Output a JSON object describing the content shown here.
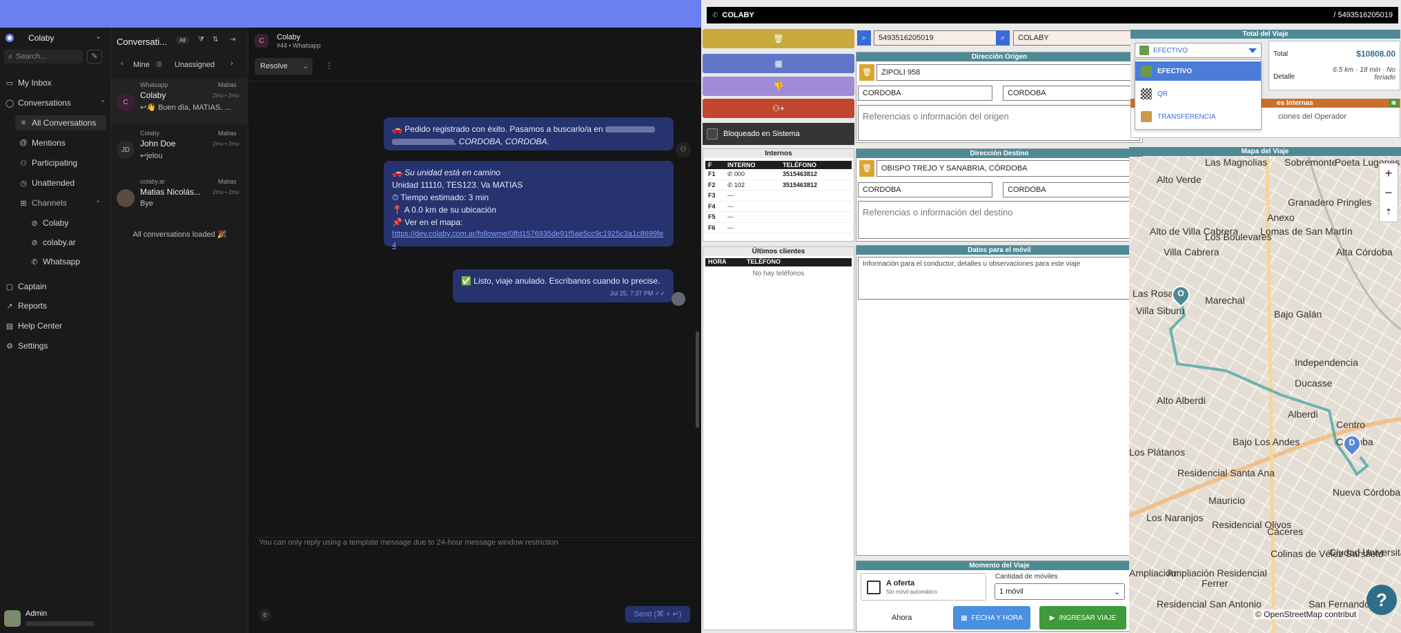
{
  "sidebar": {
    "account": "Colaby",
    "search_placeholder": "Search...",
    "items": {
      "inbox": "My Inbox",
      "conversations": "Conversations",
      "all": "All Conversations",
      "mentions": "Mentions",
      "participating": "Participating",
      "unattended": "Unattended",
      "channels": "Channels",
      "ch_colaby": "Colaby",
      "ch_colabyar": "colaby.ar",
      "ch_whatsapp": "Whatsapp",
      "captain": "Captain",
      "reports": "Reports",
      "help": "Help Center",
      "settings": "Settings"
    },
    "user": "Admin"
  },
  "convlist": {
    "title": "Conversati...",
    "filter_all": "All",
    "tab_mine": "Mine",
    "mine_count": "0",
    "tab_unassigned": "Unassigned",
    "loaded": "All conversations loaded 🎉",
    "items": [
      {
        "avatar": "C",
        "inbox": "Whatsapp",
        "agent": "Matias",
        "name": "Colaby",
        "time": "2mo • 2mo",
        "preview": "↩👋 Buen día, MATIAS. ..."
      },
      {
        "avatar": "JD",
        "inbox": "Colaby",
        "agent": "Matias",
        "name": "John Doe",
        "time": "2mo • 2mo",
        "preview": "↩jelou"
      },
      {
        "avatar": "",
        "inbox": "colaby.ar",
        "agent": "Matias",
        "name": "Matias Nicolás...",
        "time": "2mo • 2mo",
        "preview": "Bye"
      }
    ]
  },
  "chat": {
    "avatar": "C",
    "name": "Colaby",
    "sub": "#44 • Whatsapp",
    "resolve": "Resolve",
    "msg1_a": "🚗 Pedido registrado con éxito. Pasamos a buscarlo/a en",
    "msg1_b": ", CORDOBA, CORDOBA.",
    "msg2_l1": "🚗 Su unidad está en camino",
    "msg2_l2": "Unidad 11110, TES123. Va MATIAS",
    "msg2_l3": "⏱ Tiempo estimado: 3 min",
    "msg2_l4": "📍 A 0.0 km de su ubicación",
    "msg2_l5": "📌 Ver en el mapa:",
    "msg2_link": "https://dev.colaby.com.ar/followme/0ffd1576935de91f5ae5cc9c1925c3a1c8699fe4",
    "msg3": "✅ Listo, viaje anulado. Escríbanos cuando lo precise.",
    "msg3_time": "Jul 25, 7:37 PM",
    "restriction": "You can only reply using a template message due to 24-hour message window restriction",
    "send": "Send (⌘ + ↵)"
  },
  "app": {
    "brand": "COLABY",
    "phone_top": "/ 5493516205019",
    "phone": "5493516205019",
    "company": "COLABY",
    "origin_hd": "Dirección Origen",
    "origin_addr": "ZIPOLI 958",
    "origin_city1": "CORDOBA",
    "origin_city2": "CORDOBA",
    "origin_ref": "Referencias o información del origen",
    "dest_hd": "Dirección Destino",
    "dest_addr": "OBISPO TREJO Y SANABRIA, CÓRDOBA",
    "dest_city1": "CORDOBA",
    "dest_city2": "CORDOBA",
    "dest_ref": "Referencias o información del destino",
    "mobile_hd": "Datos para el móvil",
    "mobile_ph": "Información para el conductor, detalles u observaciones para este viaje",
    "blocked": "Bloqueado en Sistema",
    "internos_hd": "Internos",
    "int_cols": [
      "F",
      "INTERNO",
      "TELÉFONO"
    ],
    "int_rows": [
      [
        "F1",
        "000",
        "3515463812"
      ],
      [
        "F2",
        "102",
        "3515463812"
      ],
      [
        "F3",
        "---",
        ""
      ],
      [
        "F4",
        "---",
        ""
      ],
      [
        "F5",
        "---",
        ""
      ],
      [
        "F6",
        "---",
        ""
      ]
    ],
    "last_hd": "Últimos clientes",
    "last_cols": [
      "HORA",
      "TELÉFONO"
    ],
    "last_empty": "No hay teléfonos",
    "total_hd": "Total del Viaje",
    "pay_selected": "EFECTIVO",
    "pay_options": [
      "EFECTIVO",
      "QR",
      "TRANSFERENCIA"
    ],
    "total_label": "Total",
    "total_value": "$10808.00",
    "detail_label": "Detalle",
    "detail_value": "6.5 km · 18 min · No feriado",
    "notes_hd": "es Internas",
    "notes_text": "ciones del Operador",
    "map_hd": "Mapa del Viaje",
    "map_attr": "© OpenStreetMap contribut",
    "moment_hd": "Momento del Viaje",
    "oferta": "A oferta",
    "oferta_sub": "Sin móvil automático",
    "qty_label": "Cantidad de móviles",
    "qty_value": "1 móvil",
    "now": "Ahora",
    "date_btn": "FECHA Y HORA",
    "submit_btn": "INGRESAR VIAJE",
    "help": "?",
    "map_labels": [
      "Las Magnolias",
      "Los Boulevares",
      "Sobremonte",
      "Anexo",
      "Poeta Lugones",
      "Alto Verde",
      "Granadero Pringles",
      "Alto de Villa Cabrera",
      "Lomas de San Martín",
      "Villa Cabrera",
      "Alta Córdoba",
      "Las Rosas",
      "Marechal",
      "Bajo Galán",
      "Villa Siburu",
      "Independencia",
      "Ducasse",
      "Alto Alberdi",
      "Alberdi",
      "Centro",
      "Los Plátanos",
      "Bajo Los Andes",
      "Córdoba",
      "Residencial Santa Ana",
      "Nueva Córdoba",
      "Mauricio",
      "Los Naranjos",
      "Residencial Olivos",
      "Cáceres",
      "Colinas de Vélez Sarsfield",
      "Ciudad Universitaria",
      "Ferrer",
      "Residencial San Antonio",
      "San Fernando",
      "Ampliación Residencial",
      "Ampliación"
    ],
    "pin_o": "O",
    "pin_d": "D"
  }
}
